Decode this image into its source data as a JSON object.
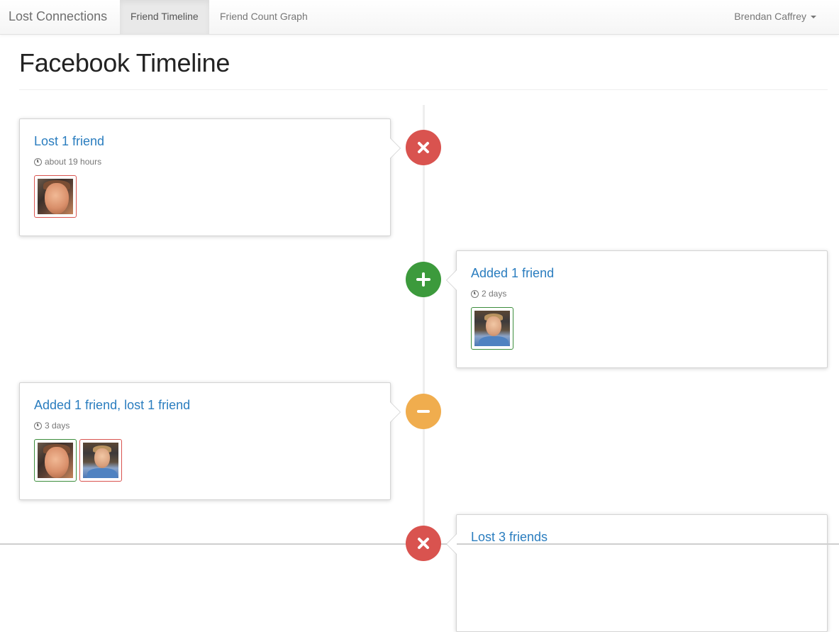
{
  "navbar": {
    "brand": "Lost Connections",
    "tabs": [
      {
        "label": "Friend Timeline",
        "active": true
      },
      {
        "label": "Friend Count Graph",
        "active": false
      }
    ],
    "user": "Brendan Caffrey"
  },
  "page": {
    "title": "Facebook Timeline"
  },
  "colors": {
    "lost": "#d9534f",
    "added": "#3c9a3c",
    "mixed": "#f0ad4e",
    "link": "#2a7dbf"
  },
  "events": [
    {
      "title": "Lost 1 friend",
      "time": "about 19 hours",
      "badge_icon": "times-icon",
      "photos": [
        {
          "kind": "lost"
        }
      ]
    },
    {
      "title": "Added 1 friend",
      "time": "2 days",
      "badge_icon": "plus-icon",
      "photos": [
        {
          "kind": "added"
        }
      ]
    },
    {
      "title": "Added 1 friend, lost 1 friend",
      "time": "3 days",
      "badge_icon": "minus-icon",
      "photos": [
        {
          "kind": "added"
        },
        {
          "kind": "lost"
        }
      ]
    },
    {
      "title": "Lost 3 friends",
      "time": "",
      "badge_icon": "times-icon",
      "photos": []
    }
  ]
}
